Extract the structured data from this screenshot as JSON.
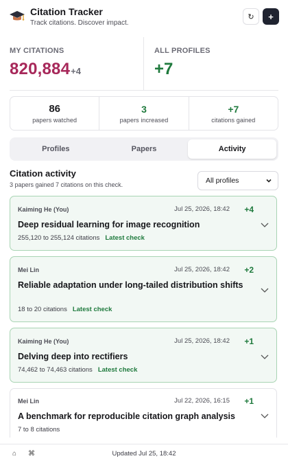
{
  "header": {
    "title": "Citation Tracker",
    "subtitle": "Track citations. Discover impact.",
    "refresh_icon": "↻",
    "add_icon": "+"
  },
  "stats": {
    "my_label": "MY CITATIONS",
    "my_value": "820,884",
    "my_delta": "+4",
    "all_label": "ALL PROFILES",
    "all_value": "+7"
  },
  "summary": [
    {
      "value": "86",
      "label": "papers watched"
    },
    {
      "value": "3",
      "label": "papers increased"
    },
    {
      "value": "+7",
      "label": "citations gained"
    }
  ],
  "tabs": [
    {
      "label": "Profiles",
      "active": false
    },
    {
      "label": "Papers",
      "active": false
    },
    {
      "label": "Activity",
      "active": true
    }
  ],
  "activity": {
    "title": "Citation activity",
    "subtitle": "3 papers gained 7 citations on this check.",
    "filter_value": "All profiles"
  },
  "cards": [
    {
      "author": "Kaiming He (You)",
      "date": "Jul 25, 2026, 18:42",
      "delta": "+4",
      "title": "Deep residual learning for image recognition",
      "meta": "255,120 to 255,124 citations",
      "tag": "Latest check"
    },
    {
      "author": "Mei Lin",
      "date": "Jul 25, 2026, 18:42",
      "delta": "+2",
      "title": "Reliable adaptation under long-tailed distribution shifts",
      "meta": "18 to 20 citations",
      "tag": "Latest check"
    },
    {
      "author": "Kaiming He (You)",
      "date": "Jul 25, 2026, 18:42",
      "delta": "+1",
      "title": "Delving deep into rectifiers",
      "meta": "74,462 to 74,463 citations",
      "tag": "Latest check"
    },
    {
      "author": "Mei Lin",
      "date": "Jul 22, 2026, 16:15",
      "delta": "+1",
      "title": "A benchmark for reproducible citation graph analysis",
      "meta": "7 to 8 citations",
      "tag": ""
    }
  ],
  "footer": {
    "home_icon": "⌂",
    "cmd_icon": "⌘",
    "updated": "Updated Jul 25, 18:42"
  },
  "colors": {
    "accent_magenta": "#a7285a",
    "green": "#1f7a3d",
    "card_border": "#a8d4b3",
    "card_bg": "#f2f8f4"
  }
}
